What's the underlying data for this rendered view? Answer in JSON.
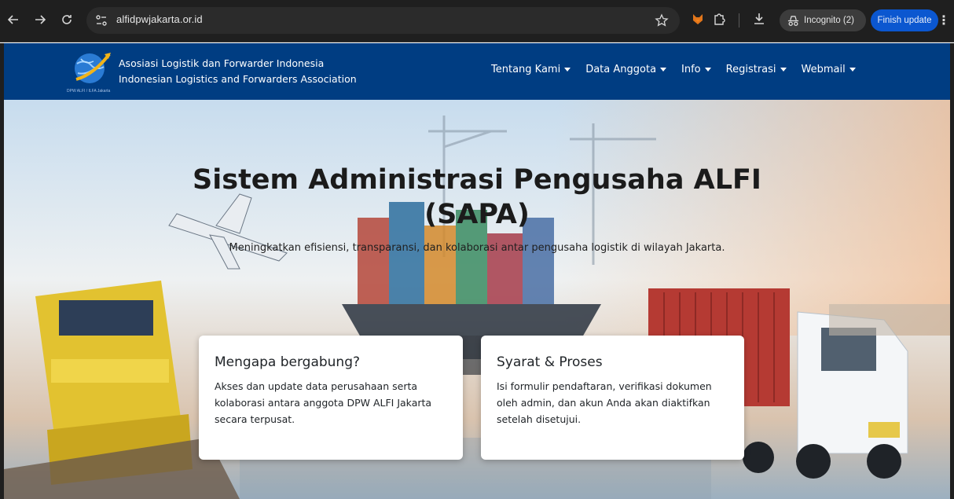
{
  "browser": {
    "url": "alfidpwjakarta.or.id",
    "incognito_label": "Incognito (2)",
    "finish_update_label": "Finish update"
  },
  "site": {
    "brand_line1": "Asosiasi Logistik dan Forwarder Indonesia",
    "brand_line2": "Indonesian Logistics and Forwarders Association",
    "logo_caption": "DPW ALFI / ILFA Jakarta",
    "menu": [
      {
        "label": "Tentang Kami"
      },
      {
        "label": "Data Anggota"
      },
      {
        "label": "Info"
      },
      {
        "label": "Registrasi"
      },
      {
        "label": "Webmail"
      }
    ]
  },
  "hero": {
    "title_line1": "Sistem Administrasi Pengusaha ALFI",
    "title_line2": "(SAPA)",
    "subtitle": "Meningkatkan efisiensi, transparansi, dan kolaborasi antar pengusaha logistik di wilayah Jakarta."
  },
  "cards": [
    {
      "title": "Mengapa bergabung?",
      "text": "Akses dan update data perusahaan serta kolaborasi antara anggota DPW ALFI Jakarta secara terpusat."
    },
    {
      "title": "Syarat & Proses",
      "text": "Isi formulir pendaftaran, verifikasi dokumen oleh admin, dan akun Anda akan diaktifkan setelah disetujui."
    }
  ],
  "colors": {
    "navbar": "#003d82",
    "chrome": "#1f1f1f",
    "finish_update": "#0b57d0"
  }
}
